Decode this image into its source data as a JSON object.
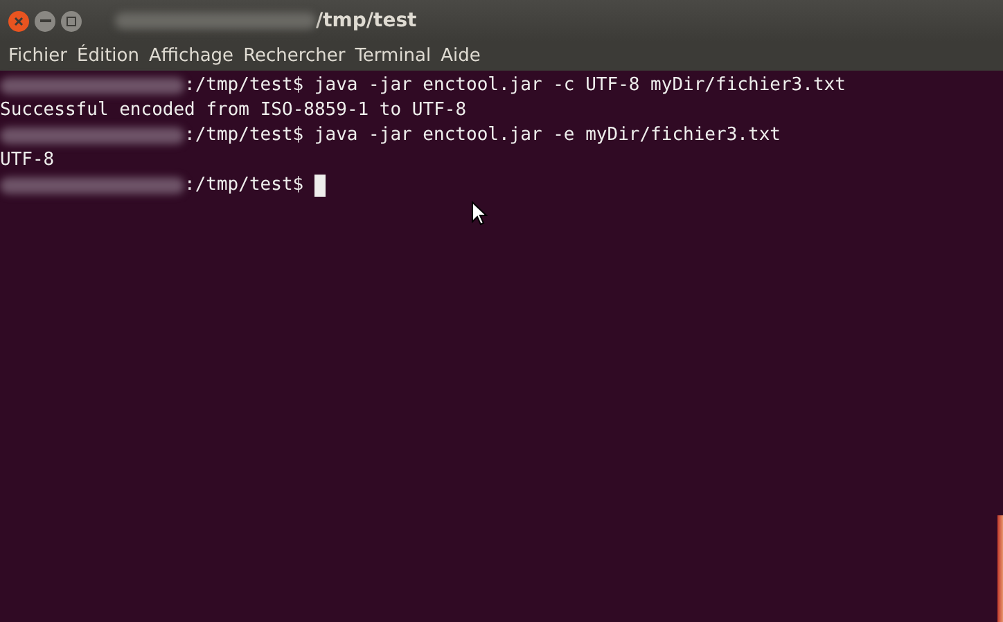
{
  "window": {
    "title": "/tmp/test"
  },
  "menu": [
    "Fichier",
    "Édition",
    "Affichage",
    "Rechercher",
    "Terminal",
    "Aide"
  ],
  "terminal": {
    "lines": [
      {
        "kind": "prompt",
        "prompt": ":/tmp/test$",
        "command": "java -jar enctool.jar -c UTF-8 myDir/fichier3.txt"
      },
      {
        "kind": "output",
        "text": "Successful encoded from ISO-8859-1 to UTF-8"
      },
      {
        "kind": "prompt",
        "prompt": ":/tmp/test$",
        "command": "java -jar enctool.jar -e myDir/fichier3.txt"
      },
      {
        "kind": "output",
        "text": "UTF-8"
      },
      {
        "kind": "prompt",
        "prompt": ":/tmp/test$",
        "cursor": true
      }
    ]
  }
}
